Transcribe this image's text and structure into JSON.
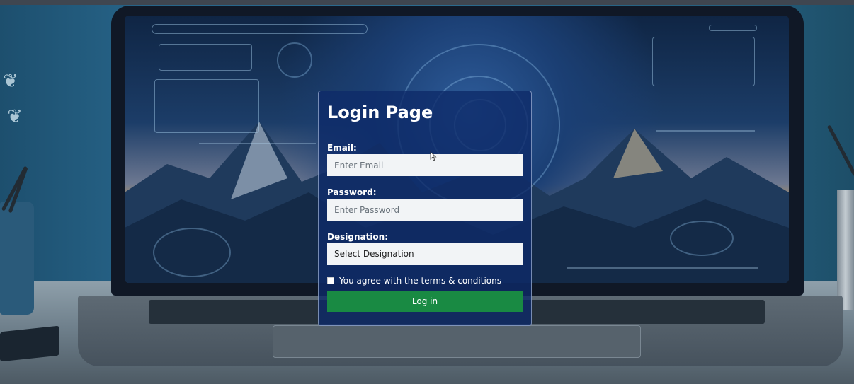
{
  "login": {
    "title": "Login Page",
    "email": {
      "label": "Email:",
      "placeholder": "Enter Email"
    },
    "password": {
      "label": "Password:",
      "placeholder": "Enter Password"
    },
    "designation": {
      "label": "Designation:",
      "selected": "Select Designation"
    },
    "terms": {
      "label": "You agree with the terms & conditions",
      "checked": false
    },
    "submit_label": "Log in"
  },
  "colors": {
    "card_background": "#0e2a69",
    "button": "#198a43",
    "input_background": "#f2f4f6"
  },
  "icons": [
    "leaf-icon",
    "cursor-icon"
  ]
}
